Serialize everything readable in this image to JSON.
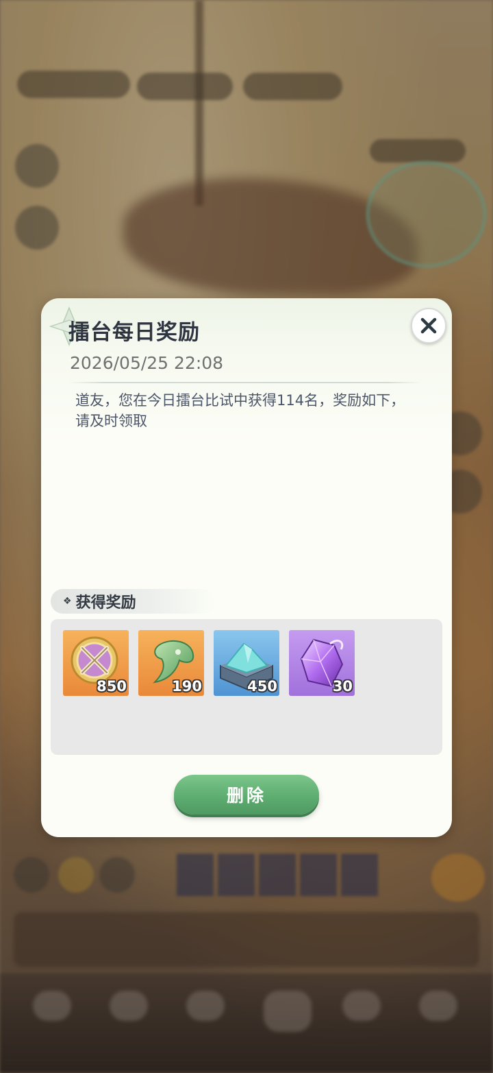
{
  "dialog": {
    "title": "擂台每日奖励",
    "date": "2026/05/25 22:08",
    "message": "道友，您在今日擂台比试中获得114名，奖励如下，请及时领取",
    "close_icon": "close-icon"
  },
  "rewards": {
    "header_icon": "diamond-sparkle-icon",
    "header": "获得奖励",
    "items": [
      {
        "icon": "crossed-swords-medal-icon",
        "quantity": "850",
        "color": "#f0a04a"
      },
      {
        "icon": "jade-pendant-icon",
        "quantity": "190",
        "color": "#f0a04a"
      },
      {
        "icon": "crystal-box-icon",
        "quantity": "450",
        "color": "#6bb2e6"
      },
      {
        "icon": "purple-crystal-icon",
        "quantity": "30",
        "color": "#b07ee0"
      }
    ]
  },
  "actions": {
    "delete_label": "删除"
  }
}
